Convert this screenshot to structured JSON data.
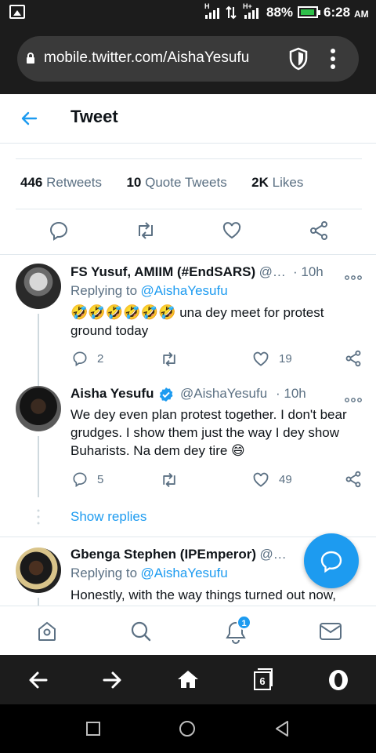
{
  "status_bar": {
    "battery": "88%",
    "time": "6:28",
    "ampm": "AM"
  },
  "browser": {
    "url": "mobile.twitter.com/AishaYesufu",
    "tabs_count": "6"
  },
  "header": {
    "title": "Tweet"
  },
  "stats": {
    "retweets_count": "446",
    "retweets_label": "Retweets",
    "quotes_count": "10",
    "quotes_label": "Quote Tweets",
    "likes_count": "2K",
    "likes_label": "Likes"
  },
  "replies": [
    {
      "name": "FS Yusuf, AMIIM (#EndSARS)",
      "handle": "@…",
      "time": "· 10h",
      "replying_prefix": "Replying to",
      "replying_to": "@AishaYesufu",
      "emojis": "🤣🤣🤣🤣🤣🤣",
      "text": " una dey meet for protest ground today",
      "reply_count": "2",
      "retweet_count": "",
      "like_count": "19"
    },
    {
      "name": "Aisha Yesufu",
      "handle": "@AishaYesufu",
      "time": "· 10h",
      "text": "We dey even plan protest together. I don't bear grudges. I show them just the way I dey show Buharists. Na dem dey tire ",
      "emoji": "😄",
      "reply_count": "5",
      "retweet_count": "",
      "like_count": "49"
    },
    {
      "name": "Gbenga Stephen (IPEmperor)",
      "handle": "@…",
      "replying_prefix": "Replying to",
      "replying_to": "@AishaYesufu",
      "text": "Honestly, with the way things turned out now,"
    }
  ],
  "show_replies": "Show replies",
  "notifications_badge": "1",
  "colors": {
    "accent": "#1d9bf0",
    "text": "#0f1419",
    "muted": "#5b7083"
  }
}
